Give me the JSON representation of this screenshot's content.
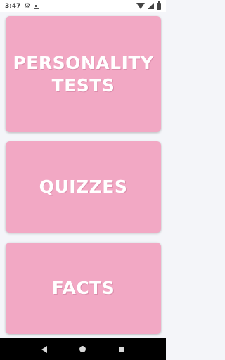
{
  "status_bar": {
    "time": "3:47",
    "icons": [
      "gear-icon",
      "notification-box-icon",
      "wifi-icon",
      "signal-icon",
      "battery-icon"
    ]
  },
  "cards": [
    {
      "label": "PERSONALITY\nTESTS"
    },
    {
      "label": "QUIZZES"
    },
    {
      "label": "FACTS"
    }
  ],
  "colors": {
    "card_background": "#f2a8c4",
    "card_text": "#ffffff",
    "page_background": "#f4f5f9",
    "nav_bar": "#000000"
  },
  "nav_bar": {
    "buttons": [
      "back-icon",
      "home-icon",
      "recents-icon"
    ]
  }
}
